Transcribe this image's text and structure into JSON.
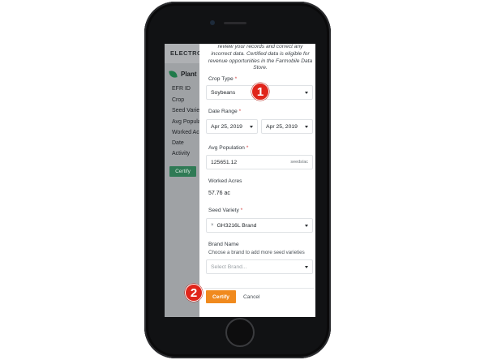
{
  "background_page": {
    "header": "ELECTRON",
    "section_title": "Plant",
    "fields": [
      "EFR ID",
      "Crop",
      "Seed Variet",
      "Avg Populat",
      "Worked Acr",
      "Date",
      "Activity"
    ],
    "certify_label": "Certify"
  },
  "modal": {
    "note_lines": [
      "review your records and correct any",
      "incorrect data. Certified data is eligible for",
      "revenue opportunities in the Farmobile Data",
      "Store."
    ],
    "crop_type": {
      "label": "Crop Type",
      "required": "*",
      "value": "Soybeans"
    },
    "date_range": {
      "label": "Date Range",
      "required": "*",
      "start": "Apr 25, 2019",
      "end": "Apr 25, 2019"
    },
    "avg_population": {
      "label": "Avg Population",
      "required": "*",
      "value": "125651.12",
      "unit": "seeds/ac"
    },
    "worked_acres": {
      "label": "Worked Acres",
      "value": "57.76 ac"
    },
    "seed_variety": {
      "label": "Seed Variety",
      "required": "*",
      "remove": "×",
      "tag": "GH3216L Brand"
    },
    "brand_name": {
      "label": "Brand Name",
      "helper": "Choose a brand to add more seed varieties",
      "placeholder": "Select Brand..."
    },
    "certify_label": "Certify",
    "cancel_label": "Cancel"
  },
  "markers": {
    "first": "1",
    "second": "2"
  },
  "colors": {
    "certify_orange": "#f08a1e",
    "marker_red": "#e0251b",
    "bg_certify_green": "#2f7a55"
  }
}
